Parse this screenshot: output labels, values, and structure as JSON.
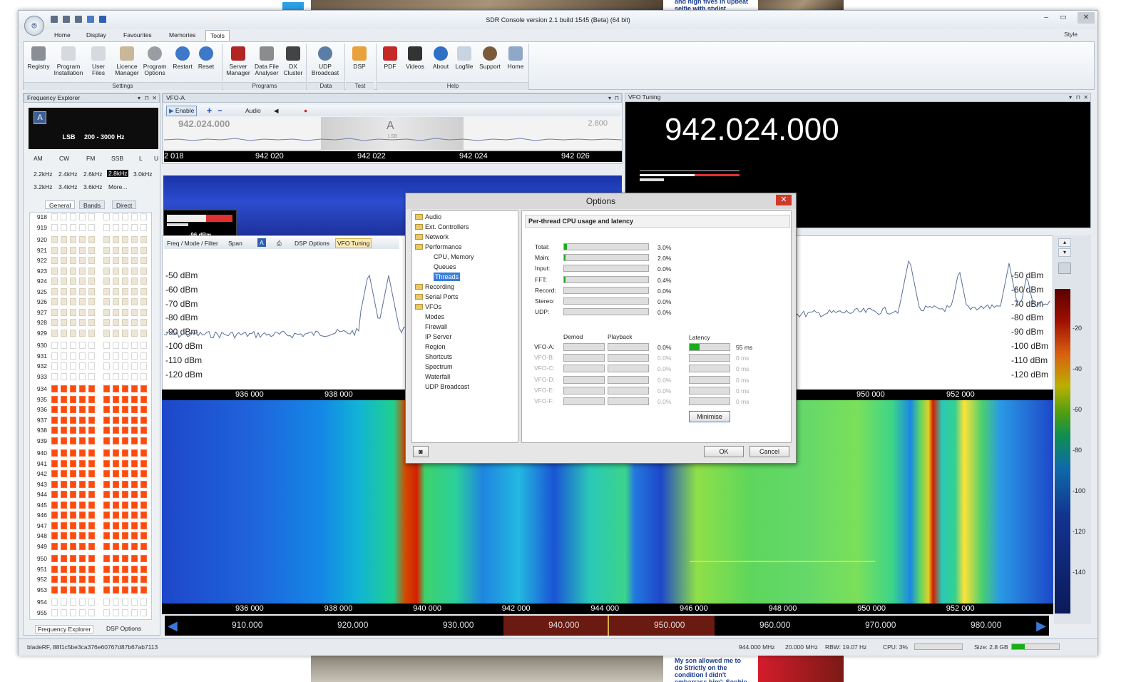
{
  "app": {
    "title": "SDR Console version 2.1 build 1545 (Beta) (64 bit)"
  },
  "ribbon_tabs": [
    "Home",
    "Display",
    "Favourites",
    "Memories",
    "Tools"
  ],
  "style_label": "Style",
  "ribbon": {
    "settings": {
      "group": "Settings",
      "items": [
        "Registry",
        "Program\nInstallation",
        "User\nFiles",
        "Licence\nManager",
        "Program\nOptions",
        "Restart",
        "Reset"
      ]
    },
    "programs": {
      "group": "Programs",
      "items": [
        "Server\nManager",
        "Data File\nAnalyser",
        "DX\nCluster"
      ]
    },
    "data": {
      "group": "Data",
      "items": [
        "UDP\nBroadcast"
      ]
    },
    "test": {
      "group": "Test",
      "items": [
        "DSP"
      ]
    },
    "help": {
      "group": "Help",
      "items": [
        "PDF",
        "Videos",
        "About",
        "Logfile",
        "Support",
        "Home"
      ]
    }
  },
  "freq_explorer": {
    "title": "Frequency Explorer",
    "vfo_letter": "A",
    "mode_line": "LSB     200 - 3000 Hz",
    "modes": [
      "AM",
      "CW",
      "FM",
      "SSB",
      "L",
      "U"
    ],
    "bandwidths": [
      "2.2kHz",
      "2.4kHz",
      "2.6kHz",
      "2.8kHz",
      "3.0kHz",
      "3.2kHz",
      "3.4kHz",
      "3.6kHz",
      "More..."
    ],
    "selected_bw": "2.8kHz",
    "tabs": [
      "General",
      "Bands",
      "Direct"
    ],
    "channels": [
      "918",
      "919",
      "920",
      "921",
      "922",
      "923",
      "924",
      "925",
      "926",
      "927",
      "928",
      "929",
      "930",
      "931",
      "932",
      "933",
      "934",
      "935",
      "936",
      "937",
      "938",
      "939",
      "940",
      "941",
      "942",
      "943",
      "944",
      "945",
      "946",
      "947",
      "948",
      "949",
      "950",
      "951",
      "952",
      "953",
      "954",
      "955"
    ],
    "bottom_tabs": [
      "Frequency Explorer",
      "DSP Options"
    ]
  },
  "vfo_a": {
    "title": "VFO-A",
    "enable": "Enable",
    "audio": "Audio",
    "strip_freq": "942.024.000",
    "strip_bw": "2.800",
    "strip_letter": "A",
    "strip_mode": "LSB",
    "scale": [
      "2 018",
      "942 020",
      "942 022",
      "942 024",
      "942 026"
    ],
    "smeter_value": "-96 dBm"
  },
  "vfo_tuning": {
    "title": "VFO Tuning",
    "frequency": "942.024.000"
  },
  "spectrum": {
    "toolbar": [
      "Freq / Mode / Filter",
      "Span",
      "A",
      "DSP Options",
      "VFO Tuning"
    ],
    "db_left": [
      "-50 dBm",
      "-60 dBm",
      "-70 dBm",
      "-80 dBm",
      "-90 dBm",
      "-100 dBm",
      "-110 dBm",
      "-120 dBm"
    ],
    "db_right": [
      "-50 dBm",
      "-60 dBm",
      "-70 dBm",
      "-80 dBm",
      "-90 dBm",
      "-100 dBm",
      "-110 dBm",
      "-120 dBm"
    ],
    "mid_scale": [
      "936 000",
      "938 000",
      "950 000",
      "952 000"
    ],
    "bottom_scale": [
      "936 000",
      "938 000",
      "940 000",
      "942 000",
      "944 000",
      "946 000",
      "948 000",
      "950 000",
      "952 000"
    ]
  },
  "colorscale": [
    "-20",
    "-40",
    "-60",
    "-80",
    "-100",
    "-120",
    "-140"
  ],
  "navigator": [
    "910.000",
    "920.000",
    "930.000",
    "940.000",
    "950.000",
    "960.000",
    "970.000",
    "980.000"
  ],
  "status": {
    "device": "bladeRF, 88f1c5be3ca376e60767d87b67ab7113",
    "center": "944.000 MHz",
    "span": "20.000 MHz",
    "rbw": "RBW: 19.07 Hz",
    "cpu": "CPU: 3%",
    "size": "Size: 2.8 GB"
  },
  "dialog": {
    "title": "Options",
    "tree": [
      "Audio",
      "Ext. Controllers",
      "Network",
      "Performance",
      "CPU, Memory",
      "Queues",
      "Threads",
      "Recording",
      "Serial Ports",
      "VFOs",
      "Modes",
      "Firewall",
      "IP Server",
      "Region",
      "Shortcuts",
      "Spectrum",
      "Waterfall",
      "UDP Broadcast"
    ],
    "header": "Per-thread CPU usage and latency",
    "threads": [
      {
        "label": "Total:",
        "value": "3.0%",
        "fill": 0.03
      },
      {
        "label": "Main:",
        "value": "2.0%",
        "fill": 0.02
      },
      {
        "label": "Input:",
        "value": "0.0%",
        "fill": 0.0
      },
      {
        "label": "FFT:",
        "value": "0.4%",
        "fill": 0.01
      },
      {
        "label": "Record:",
        "value": "0.0%",
        "fill": 0.0
      },
      {
        "label": "Stereo:",
        "value": "0.0%",
        "fill": 0.0
      },
      {
        "label": "UDP:",
        "value": "0.0%",
        "fill": 0.0
      }
    ],
    "col_demod": "Demod",
    "col_playback": "Playback",
    "col_latency": "Latency",
    "vfos": [
      {
        "label": "VFO-A:",
        "value": "0.0%",
        "latency": "55 ms",
        "lat_fill": 0.25
      },
      {
        "label": "VFO-B:",
        "value": "0.0%",
        "latency": "0 ms",
        "lat_fill": 0
      },
      {
        "label": "VFO-C:",
        "value": "0.0%",
        "latency": "0 ms",
        "lat_fill": 0
      },
      {
        "label": "VFO-D:",
        "value": "0.0%",
        "latency": "0 ms",
        "lat_fill": 0
      },
      {
        "label": "VFO-E:",
        "value": "0.0%",
        "latency": "0 ms",
        "lat_fill": 0
      },
      {
        "label": "VFO-F:",
        "value": "0.0%",
        "latency": "0 ms",
        "lat_fill": 0
      }
    ],
    "minimise": "Minimise",
    "ok": "OK",
    "cancel": "Cancel"
  },
  "background": {
    "top_text": "and high fives in upbeat\nselfie with stylist",
    "bottom_text": "My son allowed me to\ndo Strictly on the\ncondition I didn't\nembarrass him': Sophie"
  }
}
